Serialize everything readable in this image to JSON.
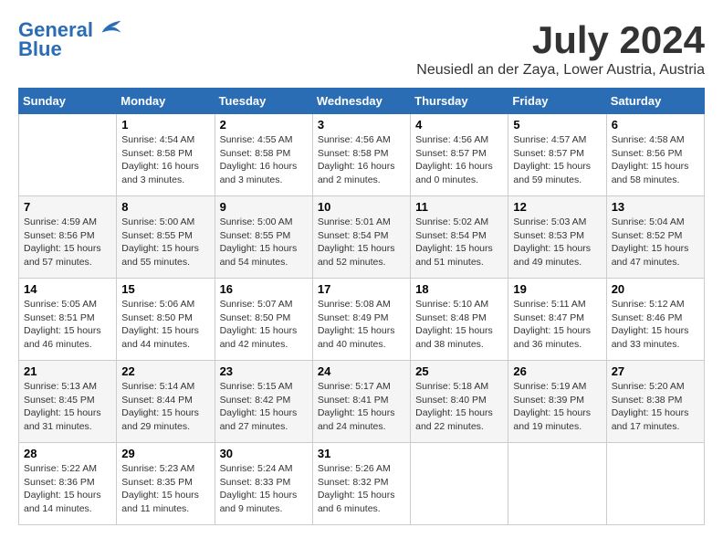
{
  "header": {
    "logo_line1": "General",
    "logo_line2": "Blue",
    "month": "July 2024",
    "location": "Neusiedl an der Zaya, Lower Austria, Austria"
  },
  "weekdays": [
    "Sunday",
    "Monday",
    "Tuesday",
    "Wednesday",
    "Thursday",
    "Friday",
    "Saturday"
  ],
  "weeks": [
    [
      {
        "day": "",
        "info": ""
      },
      {
        "day": "1",
        "info": "Sunrise: 4:54 AM\nSunset: 8:58 PM\nDaylight: 16 hours\nand 3 minutes."
      },
      {
        "day": "2",
        "info": "Sunrise: 4:55 AM\nSunset: 8:58 PM\nDaylight: 16 hours\nand 3 minutes."
      },
      {
        "day": "3",
        "info": "Sunrise: 4:56 AM\nSunset: 8:58 PM\nDaylight: 16 hours\nand 2 minutes."
      },
      {
        "day": "4",
        "info": "Sunrise: 4:56 AM\nSunset: 8:57 PM\nDaylight: 16 hours\nand 0 minutes."
      },
      {
        "day": "5",
        "info": "Sunrise: 4:57 AM\nSunset: 8:57 PM\nDaylight: 15 hours\nand 59 minutes."
      },
      {
        "day": "6",
        "info": "Sunrise: 4:58 AM\nSunset: 8:56 PM\nDaylight: 15 hours\nand 58 minutes."
      }
    ],
    [
      {
        "day": "7",
        "info": "Sunrise: 4:59 AM\nSunset: 8:56 PM\nDaylight: 15 hours\nand 57 minutes."
      },
      {
        "day": "8",
        "info": "Sunrise: 5:00 AM\nSunset: 8:55 PM\nDaylight: 15 hours\nand 55 minutes."
      },
      {
        "day": "9",
        "info": "Sunrise: 5:00 AM\nSunset: 8:55 PM\nDaylight: 15 hours\nand 54 minutes."
      },
      {
        "day": "10",
        "info": "Sunrise: 5:01 AM\nSunset: 8:54 PM\nDaylight: 15 hours\nand 52 minutes."
      },
      {
        "day": "11",
        "info": "Sunrise: 5:02 AM\nSunset: 8:54 PM\nDaylight: 15 hours\nand 51 minutes."
      },
      {
        "day": "12",
        "info": "Sunrise: 5:03 AM\nSunset: 8:53 PM\nDaylight: 15 hours\nand 49 minutes."
      },
      {
        "day": "13",
        "info": "Sunrise: 5:04 AM\nSunset: 8:52 PM\nDaylight: 15 hours\nand 47 minutes."
      }
    ],
    [
      {
        "day": "14",
        "info": "Sunrise: 5:05 AM\nSunset: 8:51 PM\nDaylight: 15 hours\nand 46 minutes."
      },
      {
        "day": "15",
        "info": "Sunrise: 5:06 AM\nSunset: 8:50 PM\nDaylight: 15 hours\nand 44 minutes."
      },
      {
        "day": "16",
        "info": "Sunrise: 5:07 AM\nSunset: 8:50 PM\nDaylight: 15 hours\nand 42 minutes."
      },
      {
        "day": "17",
        "info": "Sunrise: 5:08 AM\nSunset: 8:49 PM\nDaylight: 15 hours\nand 40 minutes."
      },
      {
        "day": "18",
        "info": "Sunrise: 5:10 AM\nSunset: 8:48 PM\nDaylight: 15 hours\nand 38 minutes."
      },
      {
        "day": "19",
        "info": "Sunrise: 5:11 AM\nSunset: 8:47 PM\nDaylight: 15 hours\nand 36 minutes."
      },
      {
        "day": "20",
        "info": "Sunrise: 5:12 AM\nSunset: 8:46 PM\nDaylight: 15 hours\nand 33 minutes."
      }
    ],
    [
      {
        "day": "21",
        "info": "Sunrise: 5:13 AM\nSunset: 8:45 PM\nDaylight: 15 hours\nand 31 minutes."
      },
      {
        "day": "22",
        "info": "Sunrise: 5:14 AM\nSunset: 8:44 PM\nDaylight: 15 hours\nand 29 minutes."
      },
      {
        "day": "23",
        "info": "Sunrise: 5:15 AM\nSunset: 8:42 PM\nDaylight: 15 hours\nand 27 minutes."
      },
      {
        "day": "24",
        "info": "Sunrise: 5:17 AM\nSunset: 8:41 PM\nDaylight: 15 hours\nand 24 minutes."
      },
      {
        "day": "25",
        "info": "Sunrise: 5:18 AM\nSunset: 8:40 PM\nDaylight: 15 hours\nand 22 minutes."
      },
      {
        "day": "26",
        "info": "Sunrise: 5:19 AM\nSunset: 8:39 PM\nDaylight: 15 hours\nand 19 minutes."
      },
      {
        "day": "27",
        "info": "Sunrise: 5:20 AM\nSunset: 8:38 PM\nDaylight: 15 hours\nand 17 minutes."
      }
    ],
    [
      {
        "day": "28",
        "info": "Sunrise: 5:22 AM\nSunset: 8:36 PM\nDaylight: 15 hours\nand 14 minutes."
      },
      {
        "day": "29",
        "info": "Sunrise: 5:23 AM\nSunset: 8:35 PM\nDaylight: 15 hours\nand 11 minutes."
      },
      {
        "day": "30",
        "info": "Sunrise: 5:24 AM\nSunset: 8:33 PM\nDaylight: 15 hours\nand 9 minutes."
      },
      {
        "day": "31",
        "info": "Sunrise: 5:26 AM\nSunset: 8:32 PM\nDaylight: 15 hours\nand 6 minutes."
      },
      {
        "day": "",
        "info": ""
      },
      {
        "day": "",
        "info": ""
      },
      {
        "day": "",
        "info": ""
      }
    ]
  ]
}
